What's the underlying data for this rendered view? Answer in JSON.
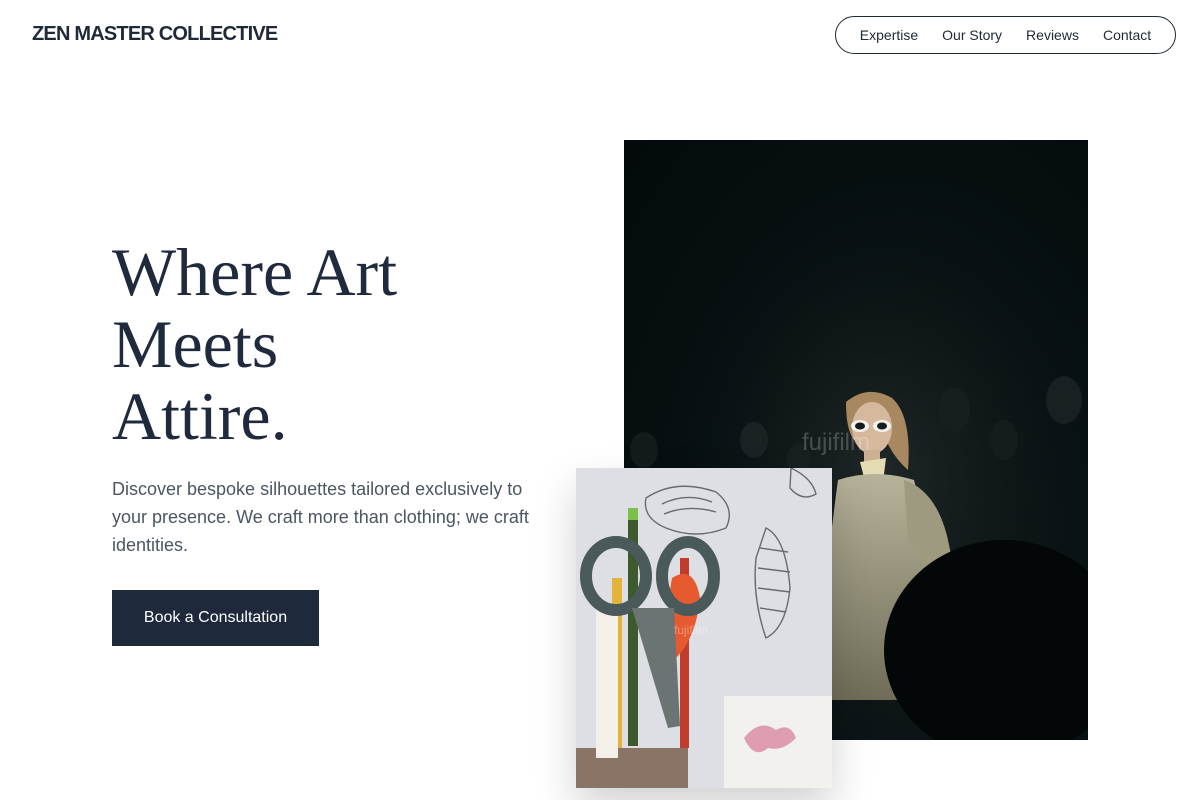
{
  "brand": {
    "name": "ZEN MASTER COLLECTIVE"
  },
  "nav": {
    "items": [
      {
        "label": "Expertise"
      },
      {
        "label": "Our Story"
      },
      {
        "label": "Reviews"
      },
      {
        "label": "Contact"
      }
    ]
  },
  "hero": {
    "title_lines": [
      "Where Art",
      "Meets",
      "Attire."
    ],
    "subtitle": "Discover bespoke silhouettes tailored exclusively to your presence. We craft more than clothing; we craft identities.",
    "cta_label": "Book a Consultation"
  },
  "images": {
    "main": {
      "watermark": "fujifilm"
    },
    "craft": {
      "watermark": "fujifilm"
    }
  },
  "colors": {
    "primary": "#1e293b",
    "text": "#1f2937",
    "muted": "#4b5563",
    "background": "#ffffff"
  }
}
